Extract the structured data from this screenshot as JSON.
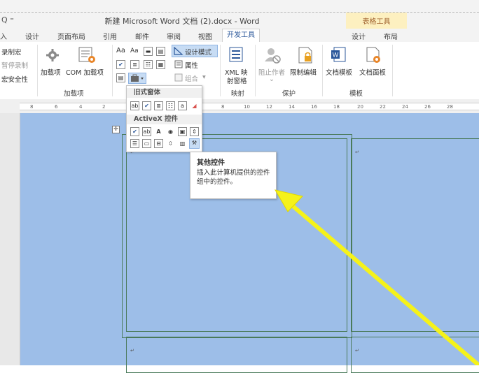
{
  "titlebar": {
    "quick_access": "Q ⁼",
    "title": "新建 Microsoft Word 文档 (2).docx - Word",
    "context_title": "表格工具"
  },
  "tabs": [
    {
      "label": "入"
    },
    {
      "label": "设计"
    },
    {
      "label": "页面布局"
    },
    {
      "label": "引用"
    },
    {
      "label": "邮件"
    },
    {
      "label": "审阅"
    },
    {
      "label": "视图"
    },
    {
      "label": "开发工具"
    },
    {
      "label": "设计"
    },
    {
      "label": "布局"
    }
  ],
  "ribbon": {
    "code": {
      "record_macro": "录制宏",
      "pause_recording": "暂停录制",
      "macro_security": "宏安全性"
    },
    "addins": {
      "addins": "加载项",
      "com_addins": "COM 加载项",
      "group_label": "加载项"
    },
    "controls": {
      "design_mode": "设计模式",
      "properties": "属性",
      "group": "组合",
      "group_arrow": "▾"
    },
    "mapping": {
      "xml_mapping_line1": "XML 映",
      "xml_mapping_line2": "射窗格",
      "group_label": "映射"
    },
    "protect": {
      "block_authors": "阻止作者",
      "restrict_editing": "限制编辑",
      "group_label": "保护"
    },
    "templates": {
      "document_template": "文档模板",
      "document_panel": "文档面板",
      "group_label": "模板"
    }
  },
  "ruler": {
    "ticks": [
      "8",
      "6",
      "4",
      "2",
      "8",
      "10",
      "12",
      "14",
      "16",
      "18",
      "20",
      "22",
      "24",
      "26",
      "28"
    ]
  },
  "dropdown": {
    "legacy_header": "旧式窗体",
    "activex_header": "ActiveX 控件"
  },
  "tooltip": {
    "title": "其他控件",
    "description": "插入此计算机提供的控件组中的控件。"
  },
  "colors": {
    "accent": "#2b579a",
    "document_bg": "#9dbee8",
    "context_band": "#fdf0c0",
    "arrow": "#f5f21a"
  }
}
